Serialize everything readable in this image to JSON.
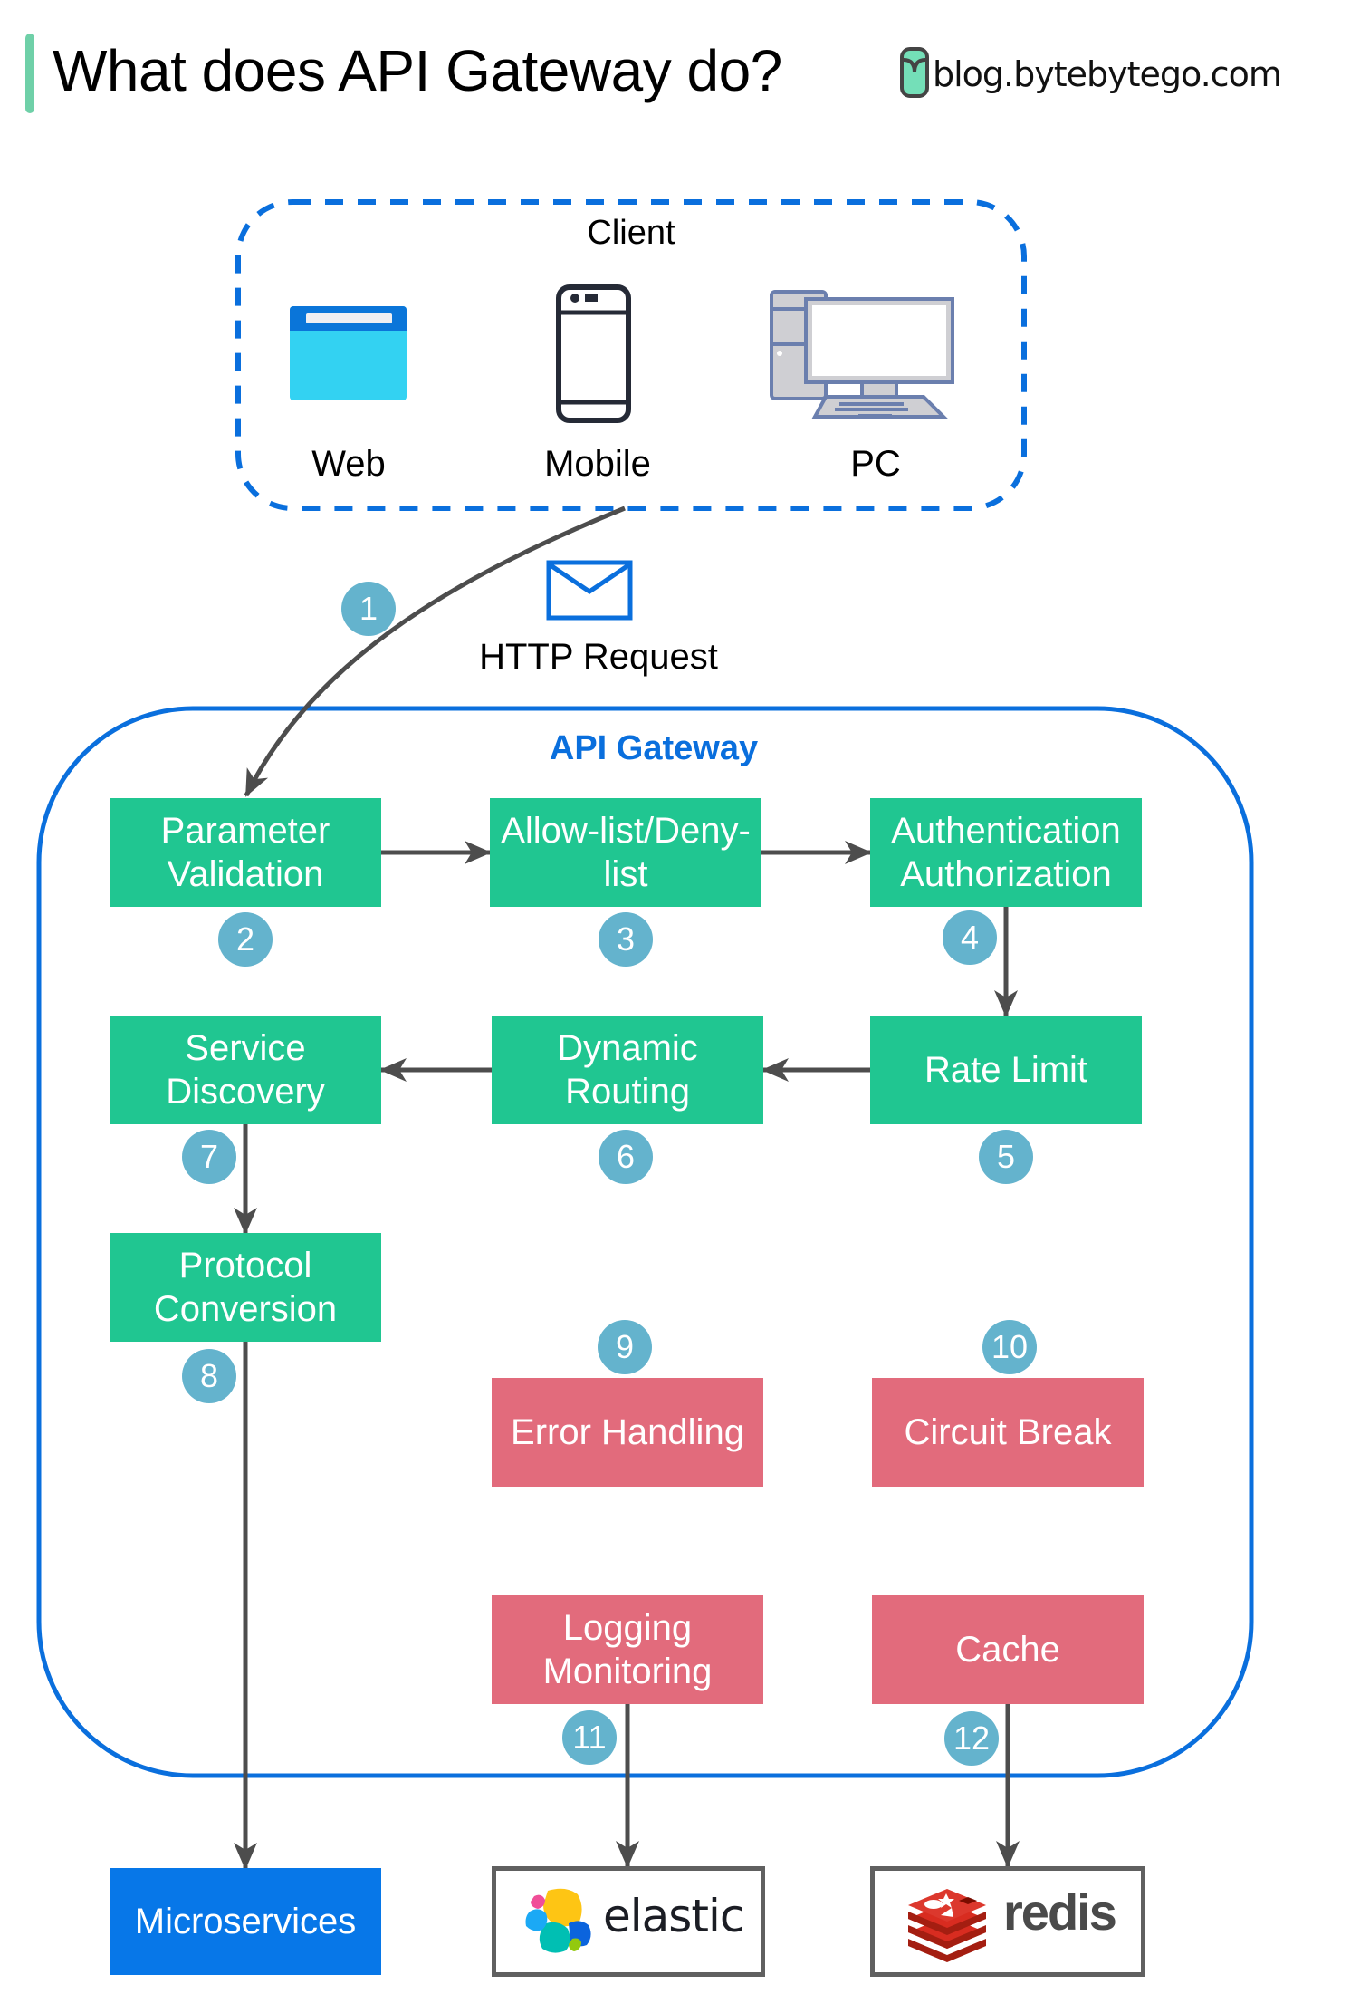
{
  "header": {
    "title": "What does API Gateway do?",
    "brand_text": "blog.bytebytego.com",
    "accent_color": "#6fd0a8"
  },
  "client": {
    "label": "Client",
    "devices": [
      {
        "label": "Web",
        "icon": "browser-window-icon"
      },
      {
        "label": "Mobile",
        "icon": "smartphone-icon"
      },
      {
        "label": "PC",
        "icon": "desktop-computer-icon"
      }
    ],
    "border_color": "#0a6fdd"
  },
  "request": {
    "label": "HTTP Request",
    "icon": "envelope-icon"
  },
  "gateway": {
    "label": "API Gateway",
    "border_color": "#0a6fdd",
    "steps": [
      {
        "number": "1",
        "label": ""
      },
      {
        "number": "2",
        "label": "Parameter Validation",
        "lines": [
          "Parameter",
          "Validation"
        ]
      },
      {
        "number": "3",
        "label": "Allow-list/Deny-list",
        "lines": [
          "Allow-list/Deny-",
          "list"
        ]
      },
      {
        "number": "4",
        "label": "Authentication Authorization",
        "lines": [
          "Authentication",
          "Authorization"
        ]
      },
      {
        "number": "5",
        "label": "Rate Limit",
        "lines": [
          "Rate Limit"
        ]
      },
      {
        "number": "6",
        "label": "Dynamic Routing",
        "lines": [
          "Dynamic",
          "Routing"
        ]
      },
      {
        "number": "7",
        "label": "Service Discovery",
        "lines": [
          "Service",
          "Discovery"
        ]
      },
      {
        "number": "8",
        "label": "Protocol Conversion",
        "lines": [
          "Protocol",
          "Conversion"
        ]
      },
      {
        "number": "9",
        "label": "Error Handling",
        "lines": [
          "Error Handling"
        ]
      },
      {
        "number": "10",
        "label": "Circuit Break",
        "lines": [
          "Circuit Break"
        ]
      },
      {
        "number": "11",
        "label": "Logging Monitoring",
        "lines": [
          "Logging",
          "Monitoring"
        ]
      },
      {
        "number": "12",
        "label": "Cache",
        "lines": [
          "Cache"
        ]
      }
    ],
    "colors": {
      "core_step": "#20c691",
      "cross_cutting": "#e26b7c",
      "badge": "#64b3cd",
      "arrow": "#4d4d4d"
    }
  },
  "backends": {
    "microservices": {
      "label": "Microservices",
      "color": "#0777e8"
    },
    "elastic": {
      "label": "elastic",
      "icon": "elastic-logo-icon"
    },
    "redis": {
      "label": "redis",
      "icon": "redis-logo-icon"
    }
  }
}
